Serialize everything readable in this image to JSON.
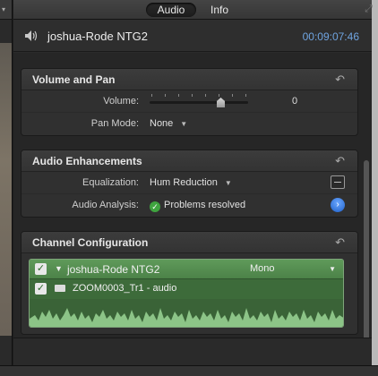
{
  "tabs": [
    {
      "label": "Audio",
      "active": true
    },
    {
      "label": "Info",
      "active": false
    }
  ],
  "header": {
    "title": "joshua-Rode NTG2",
    "timecode": "00:09:07:46"
  },
  "volume_pan": {
    "title": "Volume and Pan",
    "volume_label": "Volume:",
    "volume_value": "0",
    "pan_mode_label": "Pan Mode:",
    "pan_mode_value": "None"
  },
  "enhancements": {
    "title": "Audio Enhancements",
    "eq_label": "Equalization:",
    "eq_value": "Hum Reduction",
    "analysis_label": "Audio Analysis:",
    "analysis_value": "Problems resolved"
  },
  "channel": {
    "title": "Channel Configuration",
    "source_name": "joshua-Rode NTG2",
    "mode": "Mono",
    "clip_name": "ZOOM0003_Tr1 - audio"
  },
  "colors": {
    "timecode": "#6fa4e0",
    "clip_green": "#4c8248",
    "analysis_ok": "#3fa43f"
  },
  "icons": [
    "speaker-icon",
    "reset-icon",
    "equalizer-icon",
    "check-icon",
    "disclosure-triangle-icon",
    "clip-icon",
    "chevron-right-icon"
  ]
}
